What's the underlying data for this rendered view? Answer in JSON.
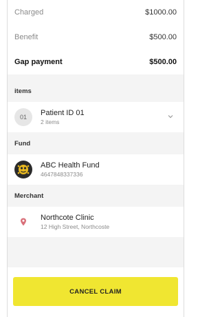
{
  "summary": {
    "charged_label": "Charged",
    "charged_value": "$1000.00",
    "benefit_label": "Benefit",
    "benefit_value": "$500.00",
    "gap_label": "Gap payment",
    "gap_value": "$500.00"
  },
  "items": {
    "header": "items",
    "badge": "01",
    "title": "Patient ID 01",
    "subtitle": "2 items",
    "icon": "chevron-down-icon"
  },
  "fund": {
    "header": "Fund",
    "name": "ABC Health Fund",
    "number": "4647848337336",
    "icon": "fund-logo-icon"
  },
  "merchant": {
    "header": "Merchant",
    "name": "Northcote Clinic",
    "address": "12 High Street, Northcoste",
    "icon": "location-pin-icon"
  },
  "actions": {
    "cancel_label": "CANCEL CLAIM",
    "cancel_color": "#f0e631"
  }
}
